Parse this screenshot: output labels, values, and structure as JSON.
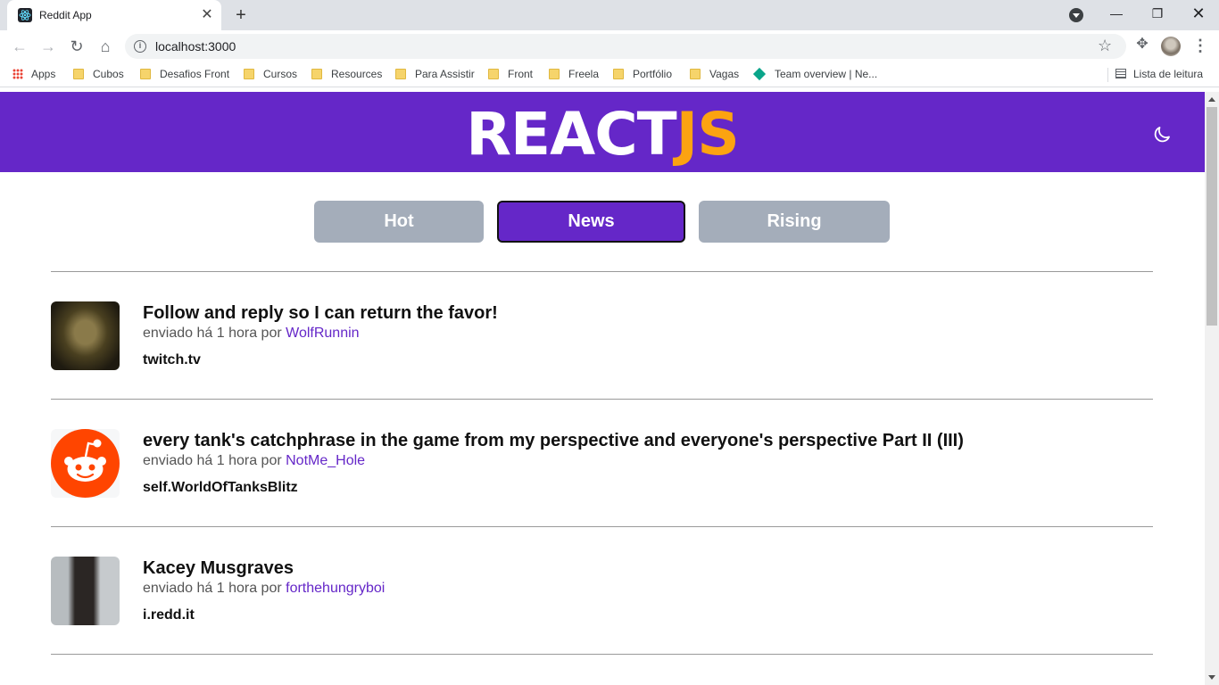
{
  "browser": {
    "tab_title": "Reddit App",
    "url": "localhost:3000",
    "bookmarks": [
      "Apps",
      "Cubos",
      "Desafios Front",
      "Cursos",
      "Resources",
      "Para Assistir",
      "Front",
      "Freela",
      "Portfólio",
      "Vagas",
      "Team overview | Ne..."
    ],
    "reading_list": "Lista de leitura"
  },
  "header": {
    "logo_main": "REACT",
    "logo_accent": "JS",
    "brand_color": "#6527c8",
    "accent_color": "#fca311",
    "theme_icon": "moon-icon"
  },
  "tabs": [
    {
      "label": "Hot",
      "active": false
    },
    {
      "label": "News",
      "active": true
    },
    {
      "label": "Rising",
      "active": false
    }
  ],
  "posts": [
    {
      "title": "Follow and reply so I can return the favor!",
      "meta_prefix": "enviado há 1 hora por",
      "author": "WolfRunnin",
      "domain": "twitch.tv"
    },
    {
      "title": "every tank's catchphrase in the game from my perspective and everyone's perspective Part II (III)",
      "meta_prefix": "enviado há 1 hora por",
      "author": "NotMe_Hole",
      "domain": "self.WorldOfTanksBlitz"
    },
    {
      "title": "Kacey Musgraves",
      "meta_prefix": "enviado há 1 hora por",
      "author": "forthehungryboi",
      "domain": "i.redd.it"
    }
  ]
}
